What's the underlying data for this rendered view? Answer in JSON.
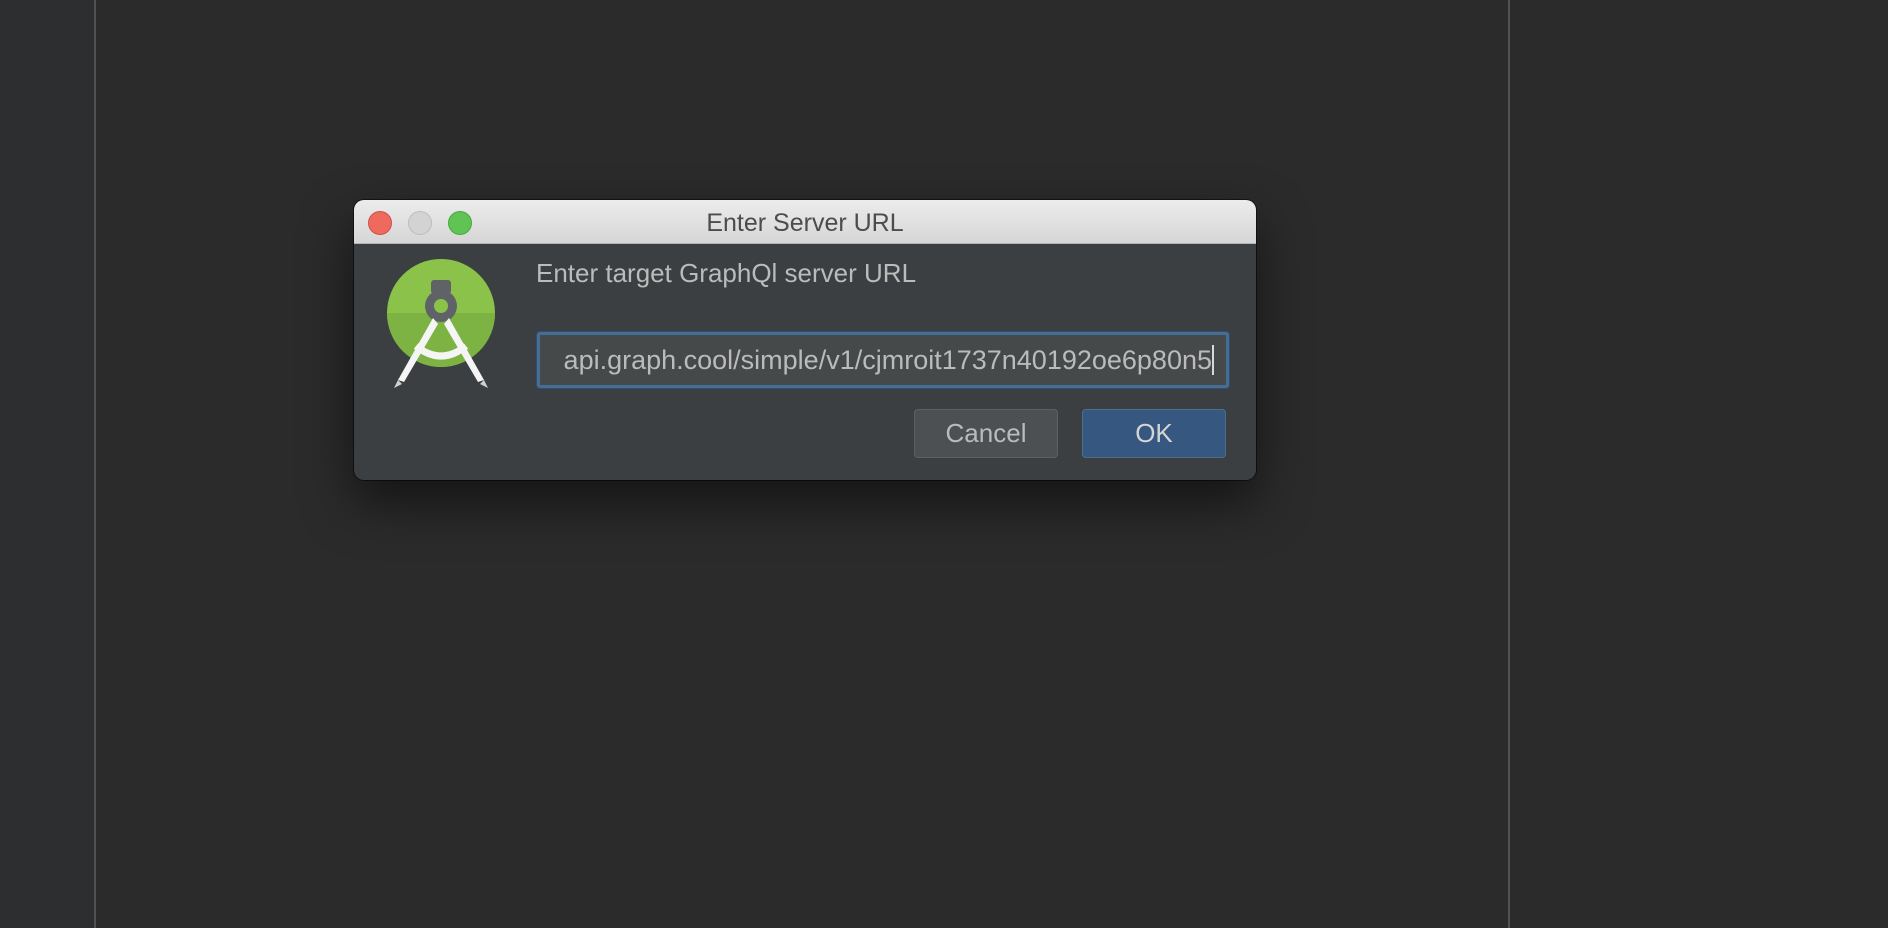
{
  "dialog": {
    "title": "Enter Server URL",
    "prompt": "Enter target GraphQl server URL",
    "url_value": "api.graph.cool/simple/v1/cjmroit1737n40192oe6p80n5",
    "cancel_label": "Cancel",
    "ok_label": "OK",
    "icon": "android-studio-icon"
  },
  "colors": {
    "background": "#2b2b2b",
    "dialog_background": "#3c3f41",
    "field_focus_border": "#466d94",
    "ok_button": "#365880",
    "close_button": "#ee6a5f",
    "maximize_button": "#5fc454"
  }
}
